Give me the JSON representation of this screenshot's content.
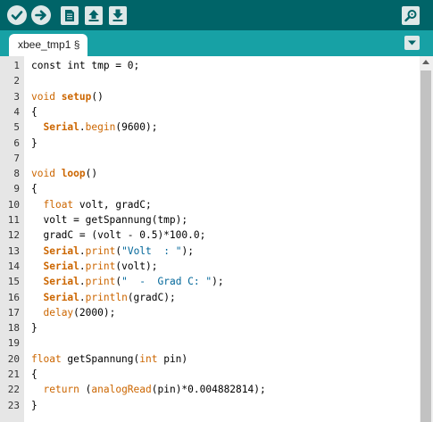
{
  "toolbar": {
    "buttons": [
      {
        "name": "verify",
        "icon": "checkmark-icon"
      },
      {
        "name": "upload",
        "icon": "arrow-right-icon"
      },
      {
        "name": "new",
        "icon": "new-file-icon"
      },
      {
        "name": "open",
        "icon": "open-arrow-up-icon"
      },
      {
        "name": "save",
        "icon": "save-arrow-down-icon"
      },
      {
        "name": "serial-monitor",
        "icon": "magnifier-icon"
      }
    ],
    "colors": {
      "bar": "#006468",
      "button": "#dfe8e8",
      "icon": "#006468"
    }
  },
  "tabs": [
    {
      "label": "xbee_tmp1 §",
      "active": true
    }
  ],
  "tab_menu_icon": "chevron-down-icon",
  "editor": {
    "lines": [
      {
        "n": "1",
        "segs": [
          {
            "t": "const int",
            "c": ""
          },
          {
            "t": " tmp = 0;",
            "c": ""
          }
        ]
      },
      {
        "n": "2",
        "segs": []
      },
      {
        "n": "3",
        "segs": [
          {
            "t": "void ",
            "c": "kw"
          },
          {
            "t": "setup",
            "c": "fn"
          },
          {
            "t": "()",
            "c": ""
          }
        ]
      },
      {
        "n": "4",
        "segs": [
          {
            "t": "{",
            "c": ""
          }
        ]
      },
      {
        "n": "5",
        "segs": [
          {
            "t": "  ",
            "c": ""
          },
          {
            "t": "Serial",
            "c": "fn"
          },
          {
            "t": ".",
            "c": ""
          },
          {
            "t": "begin",
            "c": "kw"
          },
          {
            "t": "(9600);",
            "c": ""
          }
        ]
      },
      {
        "n": "6",
        "segs": [
          {
            "t": "}",
            "c": ""
          }
        ]
      },
      {
        "n": "7",
        "segs": []
      },
      {
        "n": "8",
        "segs": [
          {
            "t": "void ",
            "c": "kw"
          },
          {
            "t": "loop",
            "c": "fn"
          },
          {
            "t": "()",
            "c": ""
          }
        ]
      },
      {
        "n": "9",
        "segs": [
          {
            "t": "{",
            "c": ""
          }
        ]
      },
      {
        "n": "10",
        "segs": [
          {
            "t": "  ",
            "c": ""
          },
          {
            "t": "float",
            "c": "kw"
          },
          {
            "t": " volt, gradC;",
            "c": ""
          }
        ]
      },
      {
        "n": "11",
        "segs": [
          {
            "t": "  volt = getSpannung(tmp);",
            "c": ""
          }
        ]
      },
      {
        "n": "12",
        "segs": [
          {
            "t": "  gradC = (volt - 0.5)*100.0;",
            "c": ""
          }
        ]
      },
      {
        "n": "13",
        "segs": [
          {
            "t": "  ",
            "c": ""
          },
          {
            "t": "Serial",
            "c": "fn"
          },
          {
            "t": ".",
            "c": ""
          },
          {
            "t": "print",
            "c": "kw"
          },
          {
            "t": "(",
            "c": ""
          },
          {
            "t": "\"Volt  : \"",
            "c": "str"
          },
          {
            "t": ");",
            "c": ""
          }
        ]
      },
      {
        "n": "14",
        "segs": [
          {
            "t": "  ",
            "c": ""
          },
          {
            "t": "Serial",
            "c": "fn"
          },
          {
            "t": ".",
            "c": ""
          },
          {
            "t": "print",
            "c": "kw"
          },
          {
            "t": "(volt);",
            "c": ""
          }
        ]
      },
      {
        "n": "15",
        "segs": [
          {
            "t": "  ",
            "c": ""
          },
          {
            "t": "Serial",
            "c": "fn"
          },
          {
            "t": ".",
            "c": ""
          },
          {
            "t": "print",
            "c": "kw"
          },
          {
            "t": "(",
            "c": ""
          },
          {
            "t": "\"  -  Grad C: \"",
            "c": "str"
          },
          {
            "t": ");",
            "c": ""
          }
        ]
      },
      {
        "n": "16",
        "segs": [
          {
            "t": "  ",
            "c": ""
          },
          {
            "t": "Serial",
            "c": "fn"
          },
          {
            "t": ".",
            "c": ""
          },
          {
            "t": "println",
            "c": "kw"
          },
          {
            "t": "(gradC);",
            "c": ""
          }
        ]
      },
      {
        "n": "17",
        "segs": [
          {
            "t": "  ",
            "c": ""
          },
          {
            "t": "delay",
            "c": "kw"
          },
          {
            "t": "(2000);",
            "c": ""
          }
        ]
      },
      {
        "n": "18",
        "segs": [
          {
            "t": "}",
            "c": ""
          }
        ]
      },
      {
        "n": "19",
        "segs": []
      },
      {
        "n": "20",
        "segs": [
          {
            "t": "float",
            "c": "kw"
          },
          {
            "t": " getSpannung(",
            "c": ""
          },
          {
            "t": "int",
            "c": "kw"
          },
          {
            "t": " pin)",
            "c": ""
          }
        ]
      },
      {
        "n": "21",
        "segs": [
          {
            "t": "{",
            "c": ""
          }
        ]
      },
      {
        "n": "22",
        "segs": [
          {
            "t": "  ",
            "c": ""
          },
          {
            "t": "return",
            "c": "kw"
          },
          {
            "t": " (",
            "c": ""
          },
          {
            "t": "analogRead",
            "c": "kw"
          },
          {
            "t": "(pin)*0.004882814);",
            "c": ""
          }
        ]
      },
      {
        "n": "23",
        "segs": [
          {
            "t": "}",
            "c": ""
          }
        ]
      }
    ]
  }
}
